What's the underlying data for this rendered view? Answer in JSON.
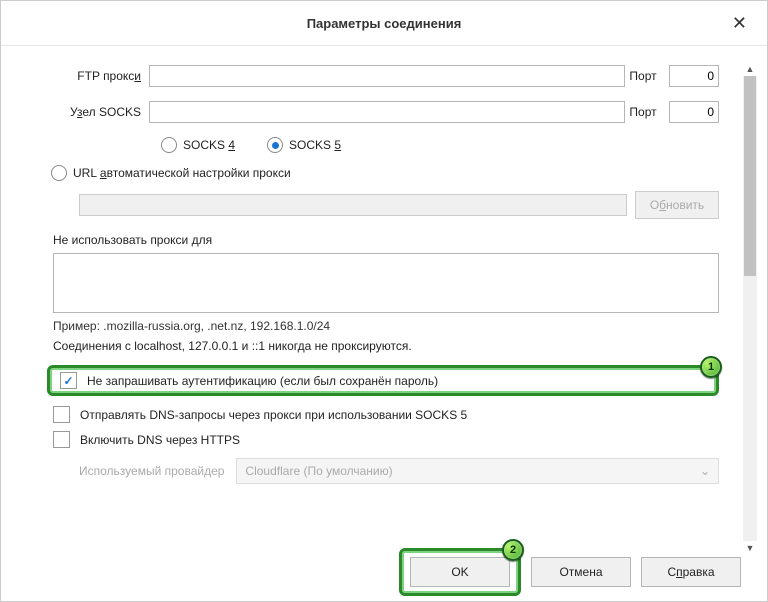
{
  "dialog": {
    "title": "Параметры соединения"
  },
  "ftp": {
    "label": "FTP прокси",
    "label_u": "и",
    "value": "",
    "port_label": "Порт",
    "port_value": "0"
  },
  "socks": {
    "label": "Узел SOCKS",
    "label_u": "з",
    "value": "",
    "port_label": "Порт",
    "port_value": "0",
    "v4_label_pre": "SOCKS ",
    "v4_label_u": "4",
    "v5_label_pre": "SOCKS ",
    "v5_label_u": "5",
    "selected": "5"
  },
  "pac": {
    "label_pre": "URL ",
    "label_u": "а",
    "label_post": "втоматической настройки прокси",
    "url": "",
    "refresh_label": "Обновить",
    "refresh_u": "б"
  },
  "noproxy": {
    "label": "Не использовать прокси для",
    "value": "",
    "example": "Пример: .mozilla-russia.org, .net.nz, 192.168.1.0/24",
    "local_note": "Соединения с localhost, 127.0.0.1 и ::1 никогда не проксируются."
  },
  "checks": {
    "auth_label": "Не запрашивать аутентификацию (если был сохранён пароль)",
    "auth_checked": true,
    "dns_socks5_label": "Отправлять DNS-запросы через прокси при использовании SOCKS 5",
    "dns_socks5_checked": false,
    "doh_label": "Включить DNS через HTTPS",
    "doh_checked": false
  },
  "provider": {
    "label": "Используемый провайдер",
    "value": "Cloudflare (По умолчанию)"
  },
  "footer": {
    "ok": "OK",
    "cancel": "Отмена",
    "help_pre": "С",
    "help_u": "п",
    "help_post": "равка"
  },
  "annotations": {
    "badge1": "1",
    "badge2": "2"
  }
}
